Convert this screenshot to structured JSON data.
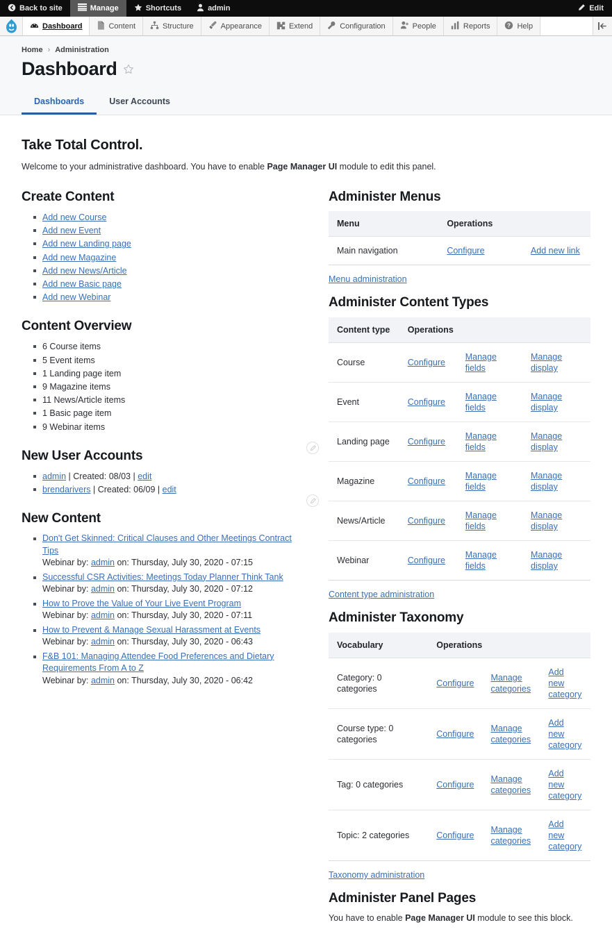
{
  "adminbar": {
    "back_to_site": "Back to site",
    "manage": "Manage",
    "shortcuts": "Shortcuts",
    "account": "admin",
    "edit": "Edit"
  },
  "toolbar": {
    "items": [
      {
        "label": "Dashboard",
        "icon": "dashboard-icon",
        "active": true
      },
      {
        "label": "Content",
        "icon": "content-icon",
        "active": false
      },
      {
        "label": "Structure",
        "icon": "structure-icon",
        "active": false
      },
      {
        "label": "Appearance",
        "icon": "appearance-icon",
        "active": false
      },
      {
        "label": "Extend",
        "icon": "extend-icon",
        "active": false
      },
      {
        "label": "Configuration",
        "icon": "configuration-icon",
        "active": false
      },
      {
        "label": "People",
        "icon": "people-icon",
        "active": false
      },
      {
        "label": "Reports",
        "icon": "reports-icon",
        "active": false
      },
      {
        "label": "Help",
        "icon": "help-icon",
        "active": false
      }
    ]
  },
  "breadcrumb": {
    "home": "Home",
    "separator": "›",
    "current": "Administration"
  },
  "page": {
    "title": "Dashboard",
    "tabs": [
      {
        "label": "Dashboards",
        "active": true
      },
      {
        "label": "User Accounts",
        "active": false
      }
    ],
    "lead": "Take Total Control.",
    "intro_before": "Welcome to your administrative dashboard. You have to enable ",
    "intro_bold": "Page Manager UI",
    "intro_after": " module to edit this panel."
  },
  "create_content": {
    "heading": "Create Content",
    "links": [
      "Add new Course",
      "Add new Event",
      "Add new Landing page",
      "Add new Magazine",
      "Add new News/Article",
      "Add new Basic page",
      "Add new Webinar"
    ]
  },
  "content_overview": {
    "heading": "Content Overview",
    "items": [
      "6 Course items",
      "5 Event items",
      "1 Landing page item",
      "9 Magazine items",
      "11 News/Article items",
      "1 Basic page item",
      "9 Webinar items"
    ]
  },
  "new_user_accounts": {
    "heading": "New User Accounts",
    "users": [
      {
        "name": "admin",
        "created_label": "| Created:",
        "created": "08/03",
        "sep": "|",
        "edit": "edit"
      },
      {
        "name": "brendarivers",
        "created_label": "| Created:",
        "created": "06/09",
        "sep": "|",
        "edit": "edit"
      }
    ]
  },
  "new_content": {
    "heading": "New Content",
    "items": [
      {
        "title": "Don't Get Skinned: Critical Clauses and Other Meetings Contract Tips",
        "type": "Webinar by:",
        "author": "admin",
        "on": "on: Thursday, July 30, 2020 - 07:15"
      },
      {
        "title": "Successful CSR Activities: Meetings Today Planner Think Tank",
        "type": "Webinar by:",
        "author": "admin",
        "on": "on: Thursday, July 30, 2020 - 07:12"
      },
      {
        "title": "How to Prove the Value of Your Live Event Program",
        "type": "Webinar by:",
        "author": "admin",
        "on": "on: Thursday, July 30, 2020 - 07:11"
      },
      {
        "title": "How to Prevent & Manage Sexual Harassment at Events",
        "type": "Webinar by:",
        "author": "admin",
        "on": "on: Thursday, July 30, 2020 - 06:43"
      },
      {
        "title": "F&B 101: Managing Attendee Food Preferences and Dietary Requirements From A to Z",
        "type": "Webinar by:",
        "author": "admin",
        "on": "on: Thursday, July 30, 2020 - 06:42"
      }
    ]
  },
  "administer_menus": {
    "heading": "Administer Menus",
    "columns": [
      "Menu",
      "Operations"
    ],
    "rows": [
      {
        "name": "Main navigation",
        "op1": "Configure",
        "op2": "Add new link"
      }
    ],
    "footer_link": "Menu administration"
  },
  "administer_content_types": {
    "heading": "Administer Content Types",
    "columns": [
      "Content type",
      "Operations"
    ],
    "rows": [
      {
        "name": "Course",
        "op1": "Configure",
        "op2": "Manage fields",
        "op3": "Manage display"
      },
      {
        "name": "Event",
        "op1": "Configure",
        "op2": "Manage fields",
        "op3": "Manage display"
      },
      {
        "name": "Landing page",
        "op1": "Configure",
        "op2": "Manage fields",
        "op3": "Manage display"
      },
      {
        "name": "Magazine",
        "op1": "Configure",
        "op2": "Manage fields",
        "op3": "Manage display"
      },
      {
        "name": "News/Article",
        "op1": "Configure",
        "op2": "Manage fields",
        "op3": "Manage display"
      },
      {
        "name": "Webinar",
        "op1": "Configure",
        "op2": "Manage fields",
        "op3": "Manage display"
      }
    ],
    "footer_link": "Content type administration"
  },
  "administer_taxonomy": {
    "heading": "Administer Taxonomy",
    "columns": [
      "Vocabulary",
      "Operations"
    ],
    "rows": [
      {
        "name": "Category: 0 categories",
        "op1": "Configure",
        "op2": "Manage categories",
        "op3": "Add new category"
      },
      {
        "name": "Course type: 0 categories",
        "op1": "Configure",
        "op2": "Manage categories",
        "op3": "Add new category"
      },
      {
        "name": "Tag: 0 categories",
        "op1": "Configure",
        "op2": "Manage categories",
        "op3": "Add new category"
      },
      {
        "name": "Topic: 2 categories",
        "op1": "Configure",
        "op2": "Manage categories",
        "op3": "Add new category"
      }
    ],
    "footer_link": "Taxonomy administration"
  },
  "administer_panel_pages": {
    "heading": "Administer Panel Pages",
    "note_before": "You have to enable ",
    "note_bold": "Page Manager UI",
    "note_after": " module to see this block."
  },
  "colors": {
    "adminbar_bg": "#0d0d0d",
    "active_tab_blue": "#2b64b0",
    "link_blue": "#3a6fb5",
    "table_header_bg": "#f2f3f6",
    "drupal_blue": "#2f9dd2"
  }
}
